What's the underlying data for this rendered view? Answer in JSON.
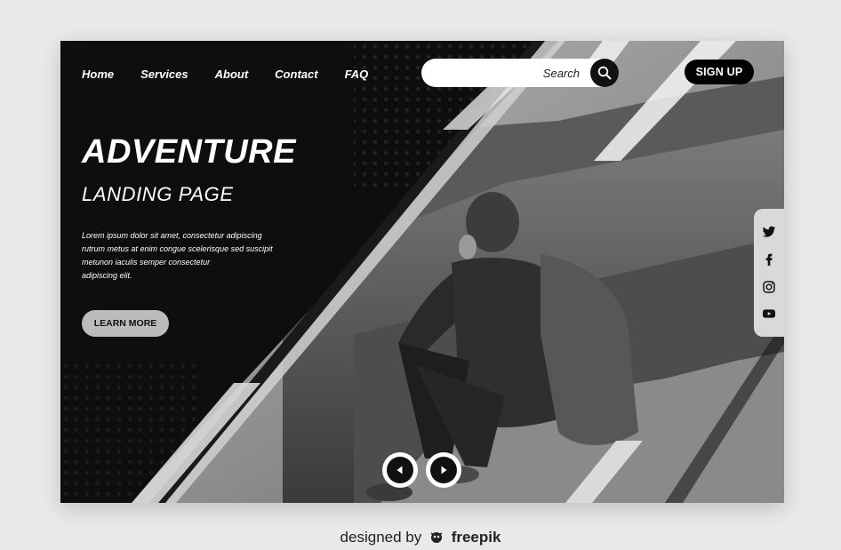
{
  "nav": {
    "items": [
      {
        "label": "Home"
      },
      {
        "label": "Services"
      },
      {
        "label": "About"
      },
      {
        "label": "Contact"
      },
      {
        "label": "FAQ"
      }
    ]
  },
  "search": {
    "placeholder": "Search"
  },
  "signup": {
    "label": "SIGN UP"
  },
  "hero": {
    "title": "ADVENTURE",
    "subtitle": "LANDING PAGE",
    "paragraph_lines": [
      "Lorem ipsum dolor sit amet, consectetur adipiscing",
      "rutrum metus at enim congue scelerisque sed suscipit",
      "metunon iaculis semper consectetur",
      "adipiscing elit."
    ],
    "button_label": "LEARN MORE"
  },
  "social": {
    "icons": [
      "twitter-icon",
      "facebook-icon",
      "instagram-icon",
      "youtube-icon"
    ]
  },
  "slider": {
    "prev_icon": "chevron-left-icon",
    "next_icon": "chevron-right-icon"
  },
  "credit": {
    "prefix": "designed by",
    "brand": "freepik"
  }
}
